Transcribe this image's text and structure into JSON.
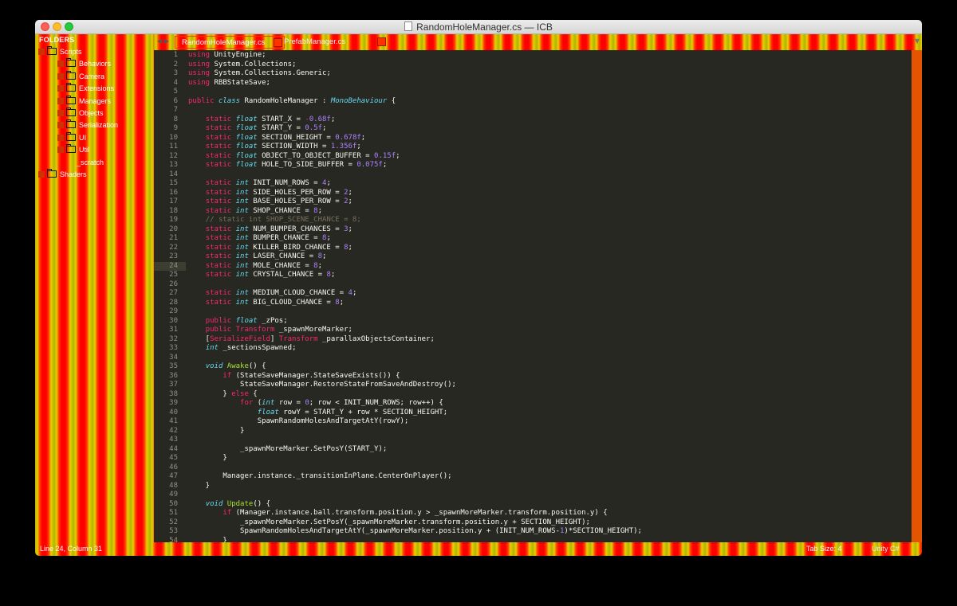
{
  "window": {
    "title": "RandomHoleManager.cs — ICB"
  },
  "sidebar": {
    "header": "FOLDERS",
    "items": [
      {
        "label": "Scripts",
        "depth": 0,
        "arrow": true
      },
      {
        "label": "Behaviors",
        "depth": 1,
        "arrow": true
      },
      {
        "label": "Camera",
        "depth": 1,
        "arrow": true
      },
      {
        "label": "Extensions",
        "depth": 1,
        "arrow": true
      },
      {
        "label": "Managers",
        "depth": 1,
        "arrow": true
      },
      {
        "label": "Objects",
        "depth": 1,
        "arrow": true
      },
      {
        "label": "Serialization",
        "depth": 1,
        "arrow": true
      },
      {
        "label": "UI",
        "depth": 1,
        "arrow": true
      },
      {
        "label": "Util",
        "depth": 1,
        "arrow": true
      },
      {
        "label": "_scratch",
        "depth": 2,
        "arrow": false
      },
      {
        "label": "Shaders",
        "depth": 0,
        "arrow": true
      }
    ]
  },
  "tabs": [
    {
      "label": "RandomHoleManager.cs",
      "active": true
    },
    {
      "label": "PrefabManager.cs",
      "active": false
    }
  ],
  "editor": {
    "current_line": 24,
    "lines": [
      "<span class=\"k\">using</span> UnityEngine;",
      "<span class=\"k\">using</span> System.Collections;",
      "<span class=\"k\">using</span> System.Collections.Generic;",
      "<span class=\"k\">using</span> RBBStateSave;",
      "",
      "<span class=\"k\">public</span> <span class=\"t\">class</span> RandomHoleManager : <span class=\"cls\">MonoBehaviour</span> {",
      "",
      "    <span class=\"k\">static</span> <span class=\"t\">float</span> START_X = <span class=\"k\">-</span><span class=\"n\">0.68f</span>;",
      "    <span class=\"k\">static</span> <span class=\"t\">float</span> START_Y = <span class=\"n\">0.5f</span>;",
      "    <span class=\"k\">static</span> <span class=\"t\">float</span> SECTION_HEIGHT = <span class=\"n\">0.678f</span>;",
      "    <span class=\"k\">static</span> <span class=\"t\">float</span> SECTION_WIDTH = <span class=\"n\">1.356f</span>;",
      "    <span class=\"k\">static</span> <span class=\"t\">float</span> OBJECT_TO_OBJECT_BUFFER = <span class=\"n\">0.15f</span>;",
      "    <span class=\"k\">static</span> <span class=\"t\">float</span> HOLE_TO_SIDE_BUFFER = <span class=\"n\">0.075f</span>;",
      "",
      "    <span class=\"k\">static</span> <span class=\"t\">int</span> INIT_NUM_ROWS = <span class=\"n\">4</span>;",
      "    <span class=\"k\">static</span> <span class=\"t\">int</span> SIDE_HOLES_PER_ROW = <span class=\"n\">2</span>;",
      "    <span class=\"k\">static</span> <span class=\"t\">int</span> BASE_HOLES_PER_ROW = <span class=\"n\">2</span>;",
      "    <span class=\"k\">static</span> <span class=\"t\">int</span> SHOP_CHANCE = <span class=\"n\">8</span>;",
      "    <span class=\"c\">// static int SHOP_SCENE_CHANCE = 8;</span>",
      "    <span class=\"k\">static</span> <span class=\"t\">int</span> NUM_BUMPER_CHANCES = <span class=\"n\">3</span>;",
      "    <span class=\"k\">static</span> <span class=\"t\">int</span> BUMPER_CHANCE = <span class=\"n\">8</span>;",
      "    <span class=\"k\">static</span> <span class=\"t\">int</span> KILLER_BIRD_CHANCE = <span class=\"n\">8</span>;",
      "    <span class=\"k\">static</span> <span class=\"t\">int</span> LASER_CHANCE = <span class=\"n\">8</span>;",
      "    <span class=\"k\">static</span> <span class=\"t\">int</span> MOLE_CHANCE = <span class=\"n\">8</span>;",
      "    <span class=\"k\">static</span> <span class=\"t\">int</span> CRYSTAL_CHANCE = <span class=\"n\">8</span>;",
      "",
      "    <span class=\"k\">static</span> <span class=\"t\">int</span> MEDIUM_CLOUD_CHANCE = <span class=\"n\">4</span>;",
      "    <span class=\"k\">static</span> <span class=\"t\">int</span> BIG_CLOUD_CHANCE = <span class=\"n\">8</span>;",
      "",
      "    <span class=\"k\">public</span> <span class=\"t\">float</span> _zPos;",
      "    <span class=\"k\">public</span> <span class=\"k\">Transform</span> _spawnMoreMarker;",
      "    [<span class=\"k\">SerializeField</span>] <span class=\"k\">Transform</span> _parallaxObjectsContainer;",
      "    <span class=\"t\">int</span> _sectionsSpawned;",
      "",
      "    <span class=\"t\">void</span> <span class=\"f\">Awake</span>() {",
      "        <span class=\"k\">if</span> (StateSaveManager.StateSaveExists()) {",
      "            StateSaveManager.RestoreStateFromSaveAndDestroy();",
      "        } <span class=\"k\">else</span> {",
      "            <span class=\"k\">for</span> (<span class=\"t\">int</span> row = <span class=\"n\">0</span>; row &lt; INIT_NUM_ROWS; row++) {",
      "                <span class=\"t\">float</span> rowY = START_Y + row * SECTION_HEIGHT;",
      "                SpawnRandomHolesAndTargetAtY(rowY);",
      "            }",
      "",
      "            _spawnMoreMarker.SetPosY(START_Y);",
      "        }",
      "",
      "        Manager.instance._transitionInPlane.CenterOnPlayer();",
      "    }",
      "",
      "    <span class=\"t\">void</span> <span class=\"f\">Update</span>() {",
      "        <span class=\"k\">if</span> (Manager.instance.ball.transform.position.y &gt; _spawnMoreMarker.transform.position.y) {",
      "            _spawnMoreMarker.SetPosY(_spawnMoreMarker.transform.position.y + SECTION_HEIGHT);",
      "            SpawnRandomHolesAndTargetAtY(_spawnMoreMarker.position.y + (INIT_NUM_ROWS-<span class=\"n\">1</span>)*SECTION_HEIGHT);",
      "        }"
    ]
  },
  "status": {
    "position": "Line 24, Column 31",
    "tab_size": "Tab Size: 4",
    "syntax": "Unity C#"
  }
}
